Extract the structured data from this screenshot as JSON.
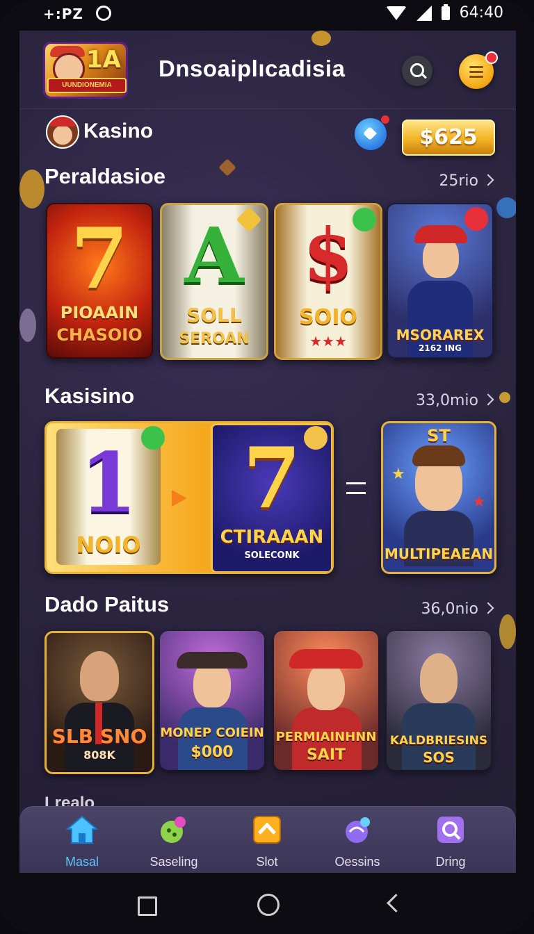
{
  "status": {
    "left_text": "+:PZ",
    "time": "64:40"
  },
  "app": {
    "title": "Dnsoaiplıcadisia",
    "logo_text": "1A",
    "logo_ribbon": "UUNDIONEMIA"
  },
  "user": {
    "name": "Kasino",
    "balance": "$625"
  },
  "sections": [
    {
      "title": "Peraldasioe",
      "more": "25rio",
      "cards": [
        {
          "big": "7",
          "label1": "PIOAAIN",
          "label2": "CHASOIO"
        },
        {
          "big": "A",
          "label1": "SOLL",
          "label2": "SEROAN"
        },
        {
          "big": "$",
          "label1": "SOIO",
          "label2": "★★★"
        },
        {
          "big": "",
          "label1": "MSORAREX",
          "label2": "2162 ING"
        }
      ]
    },
    {
      "title": "Kasisino",
      "more": "33,0mio",
      "cards": [
        {
          "big": "1",
          "label1": "NOIO",
          "label2": ""
        },
        {
          "big": "7",
          "label1": "CTIRAAAN",
          "label2": "SOLECONK"
        },
        {
          "big": "",
          "label1": "MULTIPEAEAN",
          "label2": "ST"
        }
      ]
    },
    {
      "title": "Dado Paitus",
      "more": "36,0nio",
      "cards": [
        {
          "label1": "SLB SNO",
          "label2": "808K"
        },
        {
          "label1": "MONEP COIEIN",
          "label2": "$000"
        },
        {
          "label1": "PERMIAINHNN",
          "label2": "SAIT"
        },
        {
          "label1": "KALDBRIESINS",
          "label2": "SOS"
        }
      ]
    }
  ],
  "peek_text": "Lrealo",
  "nav": [
    {
      "label": "Masal",
      "icon": "home-icon",
      "color": "#4cc3ff"
    },
    {
      "label": "Saseling",
      "icon": "dice-icon",
      "color": "#8fd34a"
    },
    {
      "label": "Slot",
      "icon": "slot-icon",
      "color": "#ffb020"
    },
    {
      "label": "Oessins",
      "icon": "chip-icon",
      "color": "#8f6cf0"
    },
    {
      "label": "Dring",
      "icon": "bag-icon",
      "color": "#a070f0"
    }
  ]
}
